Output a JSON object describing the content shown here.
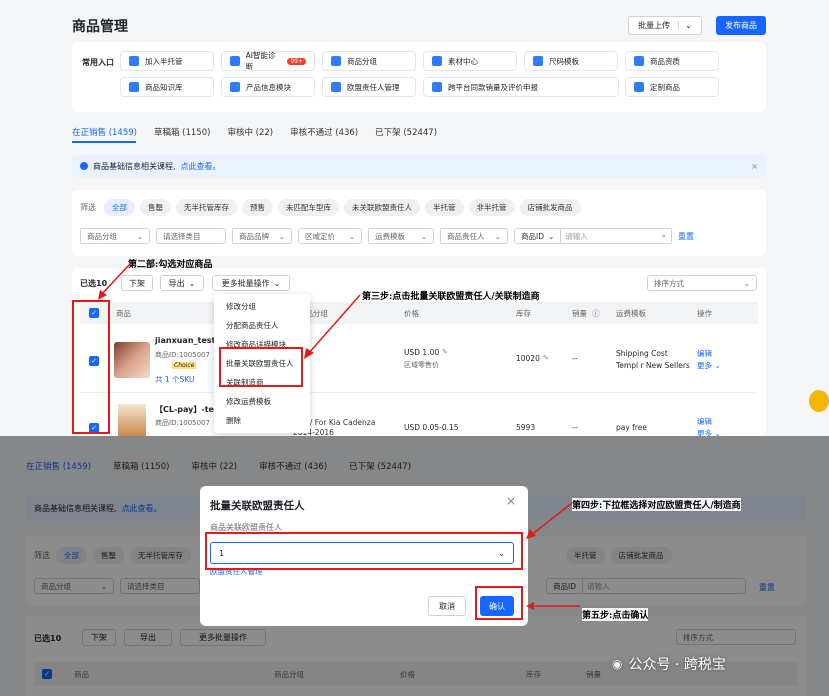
{
  "header": {
    "title": "商品管理",
    "bulk_upload": "批量上传",
    "publish": "发布商品"
  },
  "quick": {
    "label": "常用入口",
    "items": [
      "加入半托管",
      "AI智能诊断",
      "商品分组",
      "素材中心",
      "尺码模板",
      "商品资质",
      "商品知识库",
      "产品信息模块",
      "欧盟责任人管理",
      "跨平台同款销量及评价申报",
      "定制商品"
    ],
    "badge": "99+"
  },
  "tabs": [
    "在正销售 (1459)",
    "草稿箱 (1150)",
    "审核中 (22)",
    "审核不通过 (436)",
    "已下架 (52447)"
  ],
  "tabs2": [
    "在正销售 (1459)",
    "草稿箱 (1150)",
    "审核中 (22)",
    "审核不通过 (436)",
    "已下架 (52447)"
  ],
  "notice": {
    "text": "商品基础信息相关课程,",
    "link": "点此查看。"
  },
  "filter": {
    "label": "筛选",
    "pills": [
      "全部",
      "售罄",
      "无半托管库存",
      "预售",
      "未匹配车型库",
      "未关联欧盟责任人",
      "半托管",
      "非半托管",
      "店铺批发商品"
    ],
    "row2": [
      "商品分组",
      "请选择类目",
      "商品品牌",
      "区域定价",
      "运费模板",
      "商品责任人",
      "商品ID",
      "请输入"
    ],
    "reset": "重置"
  },
  "toolbar": {
    "selected": "已选10",
    "delist": "下架",
    "export": "导出",
    "more": "更多批量操作",
    "sort": "排序方式"
  },
  "menu": [
    "修改分组",
    "分配商品责任人",
    "修改商品详描模块",
    "批量关联欧盟责任人",
    "关联制造商",
    "修改运费模板",
    "删除"
  ],
  "table": {
    "headers": [
      "商品",
      "商品分组",
      "价格",
      "库存",
      "销量",
      "运费模板",
      "操作"
    ],
    "rows": [
      {
        "name": "jianxuan_test_t",
        "id": "商品ID:1005007",
        "sku": "共 1 个SKU",
        "choice": "Choice",
        "price": "USD 1.00",
        "price_note": "区域零售价",
        "stock": "10020",
        "sales": "--",
        "freight": "Shipping Cost Templ r New Sellers",
        "edit": "编辑",
        "more": "更多"
      },
      {
        "name": "【CL-pay】-test",
        "id": "商品ID:1005007",
        "group": "BAL / For Kia Cadenza 2014-2016",
        "price": "USD 0.05-0.15",
        "stock": "5993",
        "sales": "--",
        "freight": "pay free",
        "edit": "编辑",
        "more": "更多"
      }
    ]
  },
  "annotations": {
    "s2": "第二部:勾选对应商品",
    "s3": "第三步:点击批量关联欧盟责任人/关联制造商",
    "s4": "第四步:下拉框选择对应欧盟责任人/制造商",
    "s5": "第五步:点击确认"
  },
  "modal": {
    "title": "批量关联欧盟责任人",
    "label": "商品关联欧盟责任人",
    "value": "1",
    "manage": "欧盟责任人管理",
    "cancel": "取消",
    "confirm": "确认"
  },
  "lower": {
    "selected": "已选10",
    "delist": "下架",
    "export": "导出",
    "more": "更多批量操作",
    "sort": "排序方式",
    "h_goods": "商品",
    "h_group": "商品分组",
    "h_price": "价格",
    "h_stock": "库存",
    "h_sales": "销量",
    "reset": "重置",
    "id_label": "商品ID",
    "id_ph": "请输入"
  },
  "watermark": "公众号 · 跨税宝"
}
